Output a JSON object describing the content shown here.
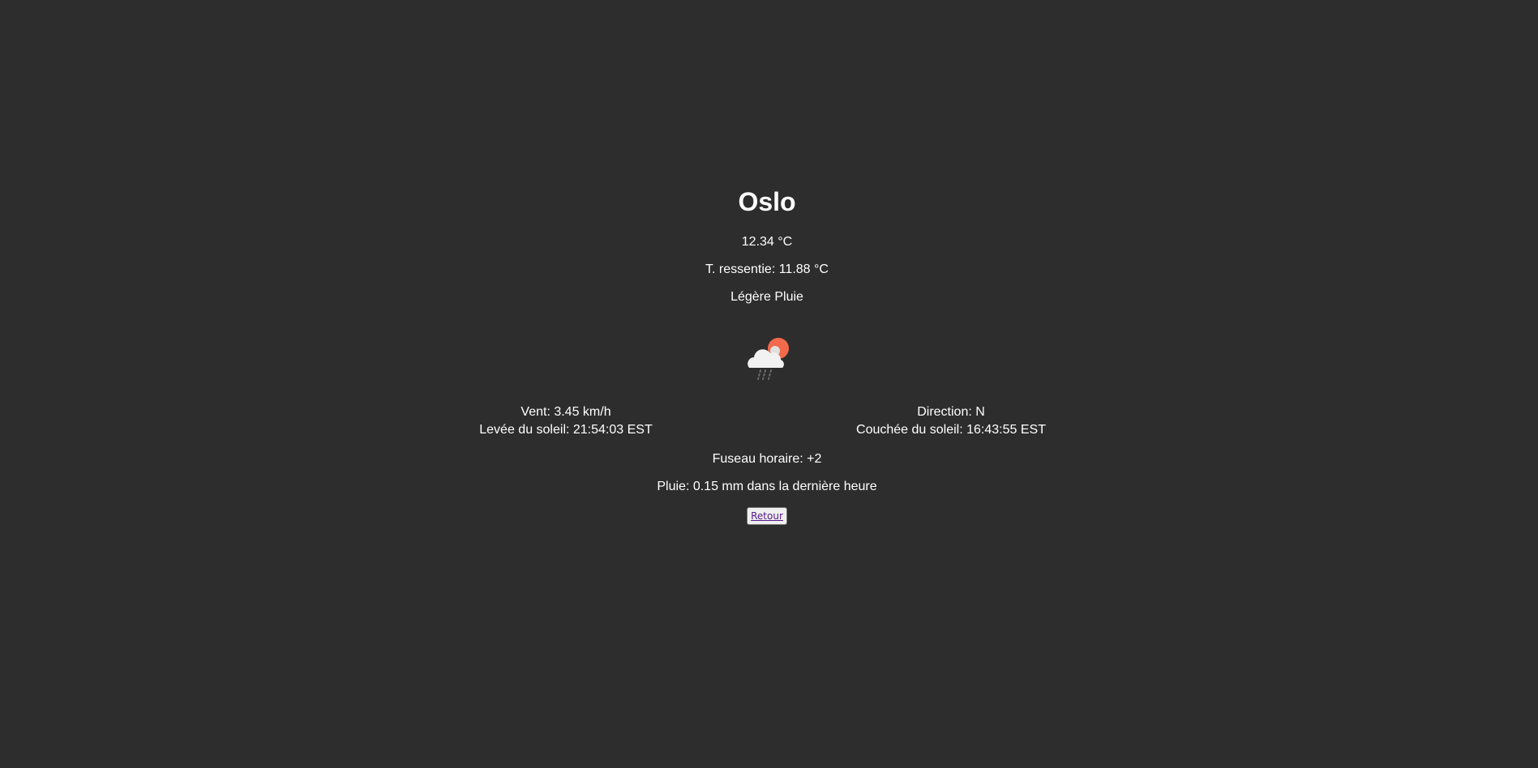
{
  "weather": {
    "city": "Oslo",
    "temperature": "12.34 °C",
    "feels_like": "T. ressentie: 11.88 °C",
    "description": "Légère Pluie",
    "icon": "cloud-sun-rain-icon",
    "wind": "Vent: 3.45 km/h",
    "direction": "Direction: N",
    "sunrise": "Levée du soleil: 21:54:03 EST",
    "sunset": "Couchée du soleil: 16:43:55 EST",
    "timezone": "Fuseau horaire: +2",
    "rain": "Pluie: 0.15 mm dans la dernière heure"
  },
  "actions": {
    "back_label": "Retour"
  },
  "colors": {
    "background": "#2d2d2d",
    "text": "#ffffff",
    "sun": "#f26a4b",
    "link": "#551a8b"
  }
}
